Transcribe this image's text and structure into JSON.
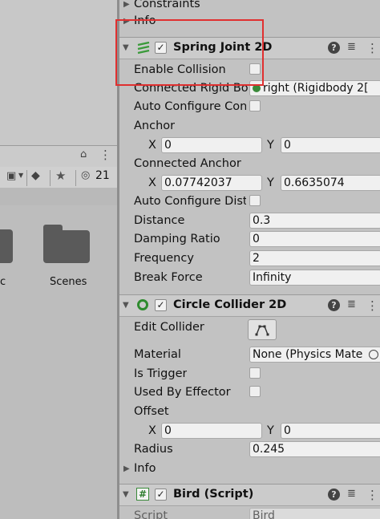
{
  "project": {
    "hidden_count": "21",
    "files": [
      {
        "label": "c"
      },
      {
        "label": "Scenes"
      }
    ]
  },
  "inspector": {
    "constraints_label": "Constraints",
    "info_label_top": "Info",
    "spring_joint": {
      "title": "Spring Joint 2D",
      "enable_collision": "Enable Collision",
      "connected_rigid_body": "Connected Rigid Bo",
      "connected_rigid_body_value": "right (Rigidbody 2[",
      "auto_configure_connected": "Auto Configure Conn",
      "anchor": "Anchor",
      "anchor_x": "0",
      "anchor_y": "0",
      "connected_anchor": "Connected Anchor",
      "connected_anchor_x": "0.07742037",
      "connected_anchor_y": "0.6635074",
      "auto_configure_distance": "Auto Configure Dista",
      "distance": "Distance",
      "distance_value": "0.3",
      "damping_ratio": "Damping Ratio",
      "damping_ratio_value": "0",
      "frequency": "Frequency",
      "frequency_value": "2",
      "break_force": "Break Force",
      "break_force_value": "Infinity"
    },
    "circle_collider": {
      "title": "Circle Collider 2D",
      "edit_collider": "Edit Collider",
      "material": "Material",
      "material_value": "None (Physics Mate",
      "is_trigger": "Is Trigger",
      "used_by_effector": "Used By Effector",
      "offset": "Offset",
      "offset_x": "0",
      "offset_y": "0",
      "radius": "Radius",
      "radius_value": "0.245",
      "info": "Info"
    },
    "bird_script": {
      "title": "Bird (Script)",
      "script_label": "Script",
      "script_value": "Bird"
    },
    "x_label": "X",
    "y_label": "Y"
  },
  "colors": {
    "highlight": "#e03030",
    "spring_icon": "#3a9a3a",
    "collider_icon": "#2e8b2e"
  },
  "icons": {
    "spring": "spring-joint-icon",
    "collider": "circle-collider-icon",
    "script": "script-hash-icon",
    "help": "help-icon",
    "preset": "preset-sliders-icon",
    "menu": "kebab-menu-icon"
  }
}
